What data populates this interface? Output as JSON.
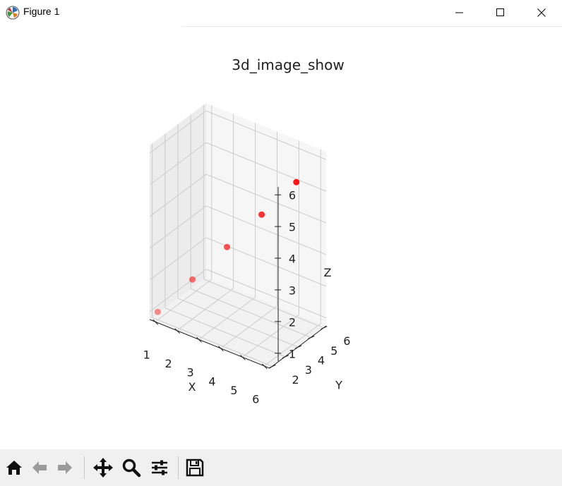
{
  "window": {
    "title": "Figure 1",
    "controls": [
      "minimize-icon",
      "maximize-icon",
      "close-icon"
    ]
  },
  "chart_data": {
    "type": "scatter",
    "title": "3d_image_show",
    "xlabel": "X",
    "ylabel": "Y",
    "zlabel": "Z",
    "xticks": [
      1,
      2,
      3,
      4,
      5,
      6
    ],
    "yticks": [
      2,
      3,
      4,
      5,
      6
    ],
    "zticks": [
      1,
      2,
      3,
      4,
      5,
      6
    ],
    "xlim": [
      0.75,
      6.25
    ],
    "ylim": [
      1.8,
      6.2
    ],
    "zlim": [
      0.75,
      6.25
    ],
    "grid": true,
    "marker_color": "#ff0000",
    "points": [
      {
        "x": 1,
        "y": 2,
        "z": 1
      },
      {
        "x": 2,
        "y": 3,
        "z": 2
      },
      {
        "x": 3,
        "y": 4,
        "z": 3
      },
      {
        "x": 4,
        "y": 5,
        "z": 4
      },
      {
        "x": 5,
        "y": 6,
        "z": 5
      }
    ]
  },
  "toolbar": {
    "buttons": [
      "home-icon",
      "back-icon",
      "forward-icon",
      "pan-icon",
      "zoom-icon",
      "configure-subplots-icon",
      "save-icon"
    ]
  }
}
